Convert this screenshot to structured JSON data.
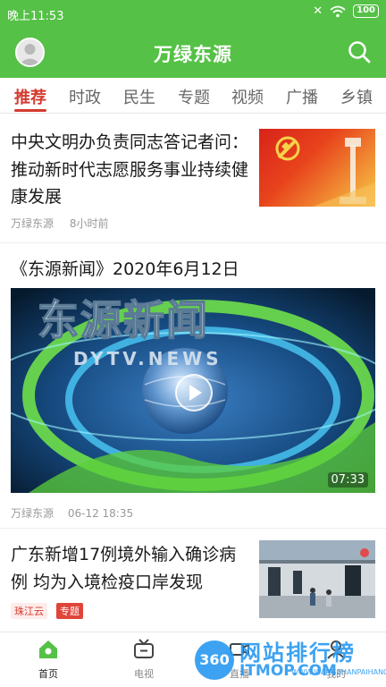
{
  "status_bar": {
    "time": "晚上11:53",
    "battery": "100"
  },
  "header": {
    "title": "万绿东源"
  },
  "tabs": [
    {
      "label": "推荐",
      "active": true
    },
    {
      "label": "时政"
    },
    {
      "label": "民生"
    },
    {
      "label": "专题"
    },
    {
      "label": "视频"
    },
    {
      "label": "广播"
    },
    {
      "label": "乡镇"
    }
  ],
  "feed": {
    "article1": {
      "title": "中央文明办负责同志答记者问：推动新时代志愿服务事业持续健康发展",
      "source": "万绿东源",
      "time": "8小时前"
    },
    "video": {
      "title": "《东源新闻》2020年6月12日",
      "overlay_title": "东源新闻",
      "overlay_sub": "DYTV.NEWS",
      "duration": "07:33",
      "source": "万绿东源",
      "time": "06-12 18:35"
    },
    "article3": {
      "title": "广东新增17例境外输入确诊病例 均为入境检疫口岸发现",
      "source_tag": "珠江云",
      "topic_tag": "专题"
    }
  },
  "bottom_nav": [
    {
      "label": "首页",
      "icon": "home-icon",
      "active": true
    },
    {
      "label": "电视",
      "icon": "tv-icon"
    },
    {
      "label": "直播",
      "icon": "video-camera-icon"
    },
    {
      "label": "我的",
      "icon": "user-icon"
    }
  ],
  "watermark": {
    "badge": "360",
    "main": "网站排行榜",
    "sub": "ITMOP.COM",
    "url": "WWW.WANGZHANPAIHANG"
  },
  "colors": {
    "brand_green": "#55c146",
    "accent_red": "#d43a2f",
    "watermark_blue": "#2d9bf0"
  }
}
